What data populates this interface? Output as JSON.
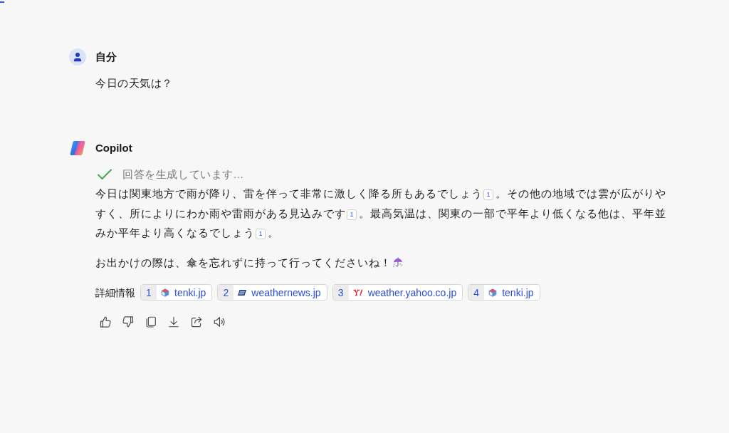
{
  "loading_bar": {
    "level": 0.006
  },
  "messages": [
    {
      "kind": "user",
      "sender": "自分",
      "text": "今日の天気は？"
    },
    {
      "kind": "assistant",
      "sender": "Copilot",
      "status": {
        "text": "回答を生成しています...",
        "done": true
      },
      "paragraphs": [
        [
          {
            "kind": "text",
            "text": "今日は関東地方で雨が降り、雷を伴って非常に激しく降る所もあるでしょう"
          },
          {
            "kind": "cite",
            "text": "1"
          },
          {
            "kind": "text",
            "text": "。その他の地域では雲が広がりやすく、所によりにわか雨や雷雨がある見込みです"
          },
          {
            "kind": "cite",
            "text": "1"
          },
          {
            "kind": "text",
            "text": "。最高気温は、関東の一部で平年より低くなる他は、平年並みか平年より高くなるでしょう"
          },
          {
            "kind": "cite",
            "text": "1"
          },
          {
            "kind": "text",
            "text": "。"
          }
        ],
        [
          {
            "kind": "text",
            "text": "お出かけの際は、傘を忘れずに持って行ってくださいね！"
          },
          {
            "kind": "icon"
          }
        ]
      ],
      "sources_label": "詳細情報",
      "sources": [
        {
          "number": "1",
          "kind": "cube",
          "domain": "tenki.jp"
        },
        {
          "number": "2",
          "kind": "banner",
          "domain": "weathernews.jp"
        },
        {
          "number": "3",
          "kind": "letter",
          "domain": "weather.yahoo.co.jp"
        },
        {
          "number": "4",
          "kind": "cube",
          "domain": "tenki.jp"
        }
      ]
    }
  ]
}
